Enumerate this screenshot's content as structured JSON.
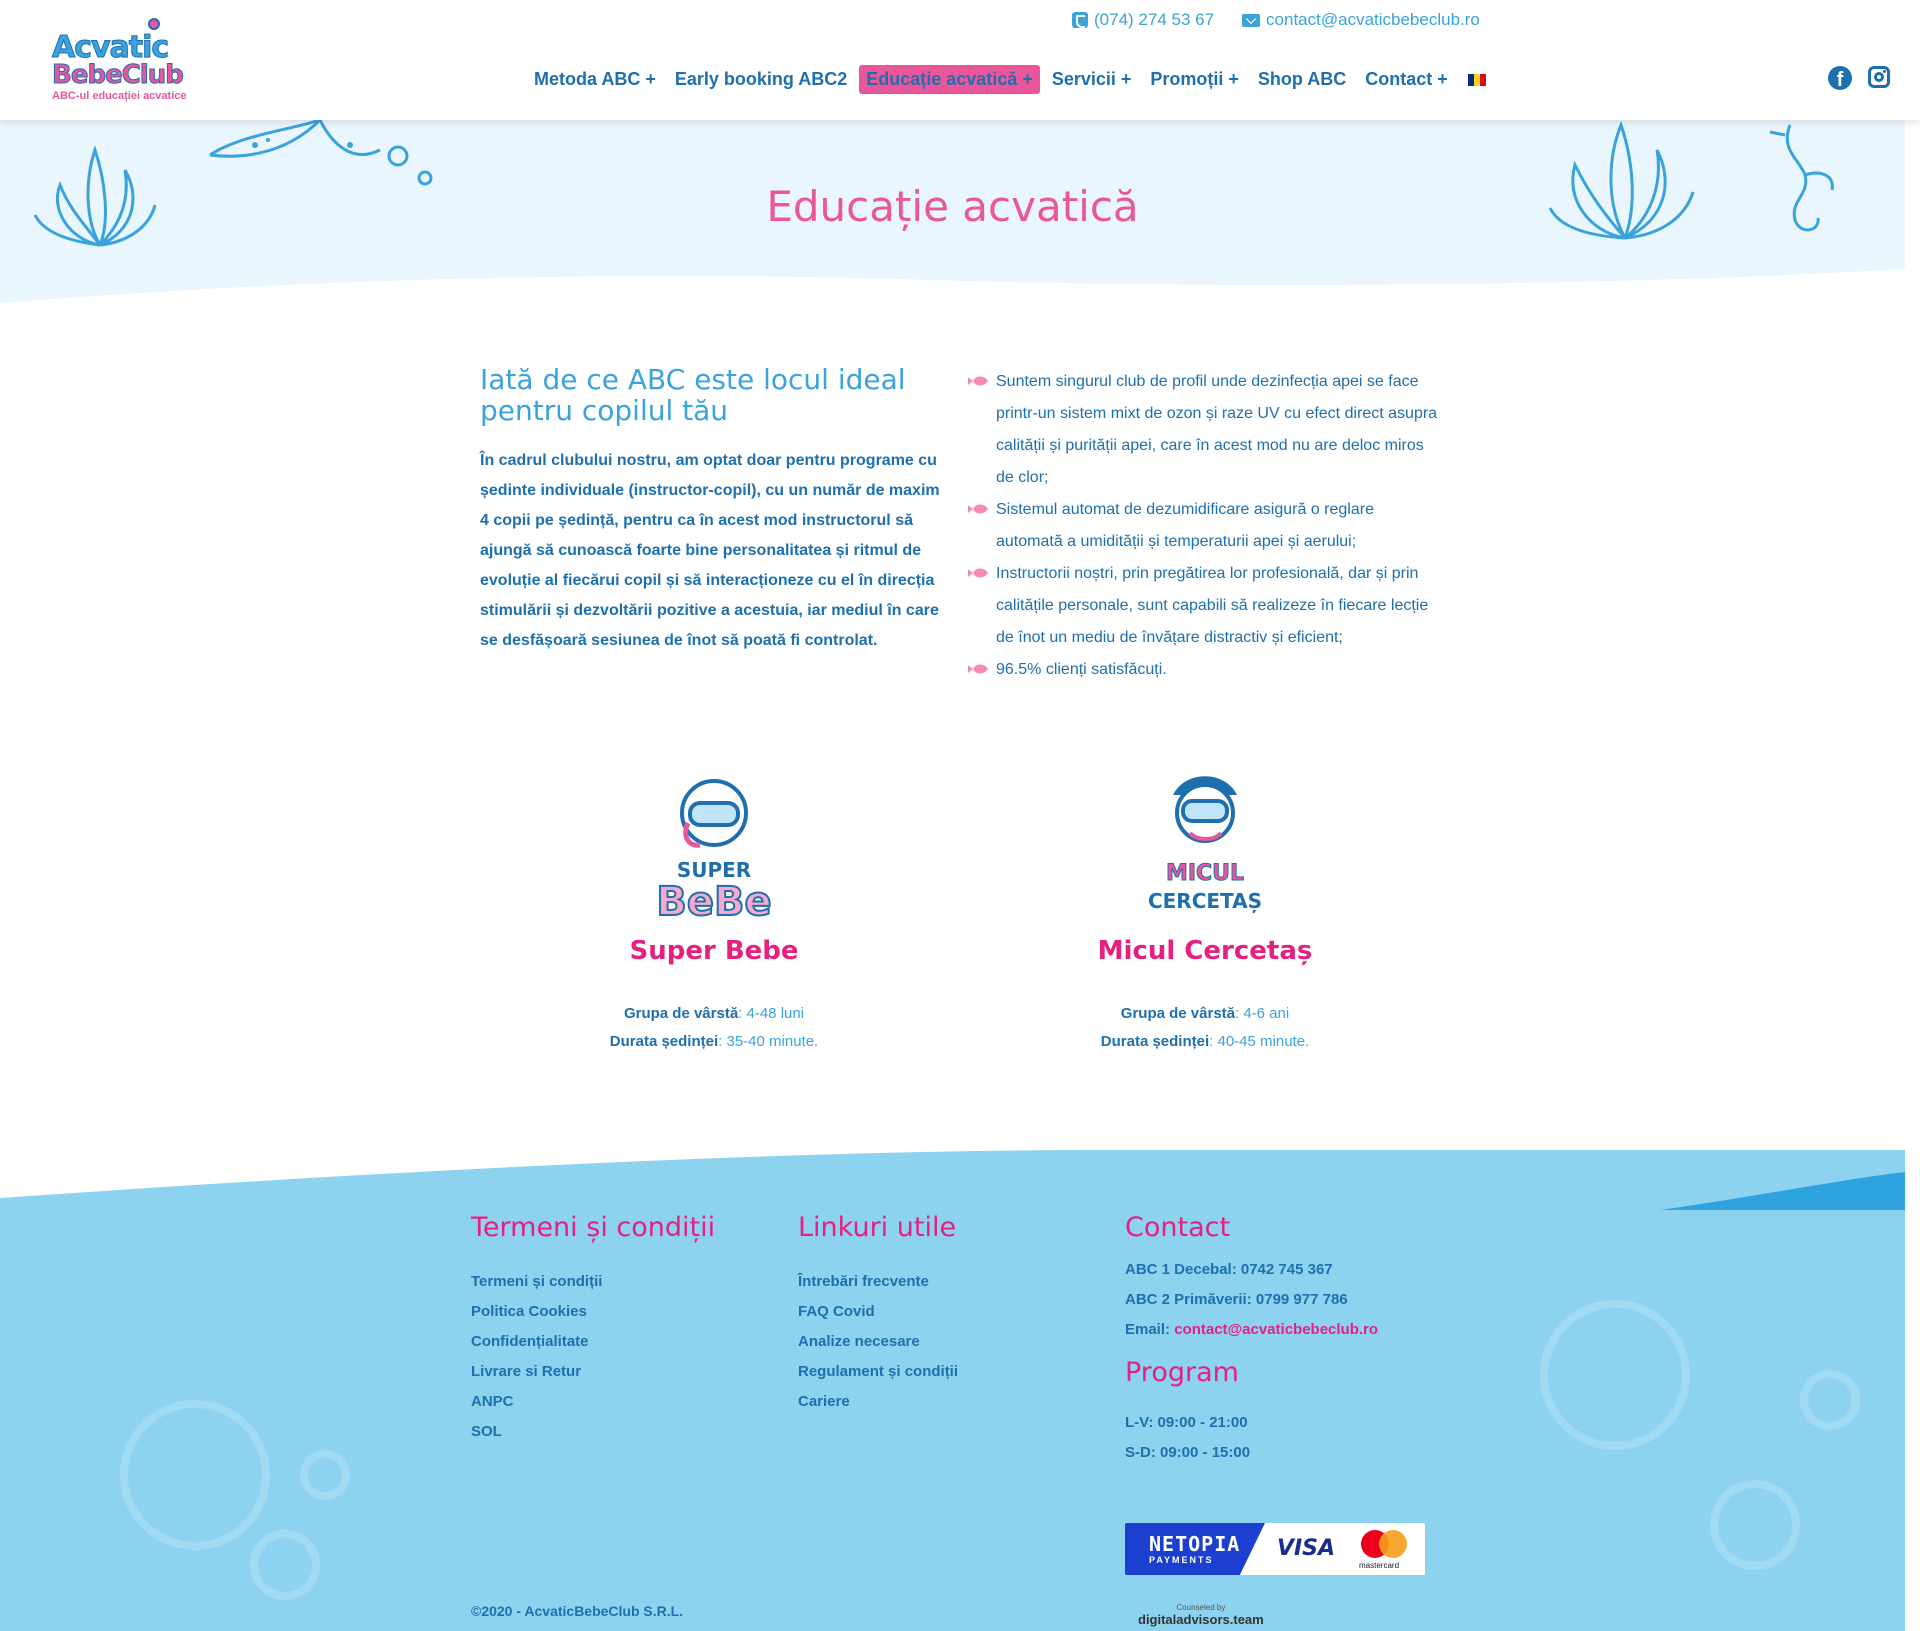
{
  "brand": {
    "logo_line1": "Acvatic",
    "logo_line2": "BebeClub",
    "tagline": "ABC-ul educației acvatice"
  },
  "topbar": {
    "phone": "(074) 274 53 67",
    "email": "contact@acvaticbebeclub.ro"
  },
  "nav": {
    "items": [
      {
        "label": "Metoda ABC +"
      },
      {
        "label": "Early booking ABC2"
      },
      {
        "label": "Educație acvatică +"
      },
      {
        "label": "Servicii +"
      },
      {
        "label": "Promoții +"
      },
      {
        "label": "Shop ABC"
      },
      {
        "label": "Contact +"
      }
    ],
    "active_index": 2,
    "active_color": "#e9579a"
  },
  "social": {
    "facebook_glyph": "f"
  },
  "hero": {
    "title": "Educație acvatică"
  },
  "intro": {
    "heading": "Iată de ce ABC este locul ideal pentru copilul tău",
    "paragraph": "În cadrul clubului nostru, am optat doar pentru programe cu ședinte individuale (instructor-copil), cu un număr de maxim 4 copii pe ședință, pentru ca în acest mod instructorul să ajungă să cunoască foarte bine personalitatea și ritmul de evoluție al fiecărui copil și să interacționeze cu el în direcția stimulării și dezvoltării pozitive a acestuia, iar mediul în care se desfășoară sesiunea de înot să poată fi controlat."
  },
  "features": [
    "Suntem singurul club de profil unde dezinfecția apei se face printr-un sistem mixt de ozon și raze UV cu efect direct asupra calității și purității apei, care în acest mod nu are deloc miros de clor;",
    "Sistemul automat de dezumidificare asigură o reglare automată a umidității și temperaturii apei și aerului;",
    "Instructorii noștri, prin pregătirea lor profesională, dar și prin calitățile personale, sunt capabili să realizeze în fiecare lecție de înot un mediu de învățare distractiv și eficient;",
    "96.5% clienți satisfăcuți."
  ],
  "programs": [
    {
      "mascot_text_top": "SUPER",
      "mascot_text_bottom": "BeBe",
      "name": "Super Bebe",
      "age_label": "Grupa de vârstă",
      "age_value": ": 4-48 luni",
      "duration_label": "Durata ședinței",
      "duration_value": ": 35-40 minute."
    },
    {
      "mascot_text_top": "MICUL",
      "mascot_text_bottom": "CERCETAȘ",
      "name": "Micul Cercetaș",
      "age_label": "Grupa de vârstă",
      "age_value": ": 4-6 ani",
      "duration_label": "Durata ședinței",
      "duration_value": ": 40-45 minute."
    }
  ],
  "footer": {
    "terms": {
      "title": "Termeni și condiții",
      "links": [
        "Termeni și condiții",
        "Politica Cookies",
        "Confidențialitate",
        "Livrare si Retur",
        "ANPC",
        "SOL"
      ]
    },
    "useful": {
      "title": "Linkuri utile",
      "links": [
        "Întrebări frecvente",
        "FAQ Covid",
        "Analize necesare",
        "Regulament și condiții",
        "Cariere"
      ]
    },
    "contact": {
      "title": "Contact",
      "abc1": "ABC 1 Decebal: 0742 745 367",
      "abc2": "ABC 2 Primăverii: 0799 977 786",
      "email_label": "Email: ",
      "email": "contact@acvaticbebeclub.ro"
    },
    "program": {
      "title": "Program",
      "weekdays": "L-V: 09:00 - 21:00",
      "weekend": "S-D: 09:00 - 15:00"
    },
    "payments": {
      "netopia": "NETOPIA",
      "netopia_sub": "PAYMENTS",
      "visa": "VISA",
      "mastercard": "mastercard"
    },
    "copyright": "©2020 - AcvaticBebeClub S.R.L.",
    "credit_small": "Counseled by",
    "credit_brand": "digitaladvisors.team"
  },
  "colors": {
    "primary": "#1d6fae",
    "accent": "#e9579a",
    "light_blue": "#3aa3dc",
    "footer_bg": "#8dd3f0"
  }
}
